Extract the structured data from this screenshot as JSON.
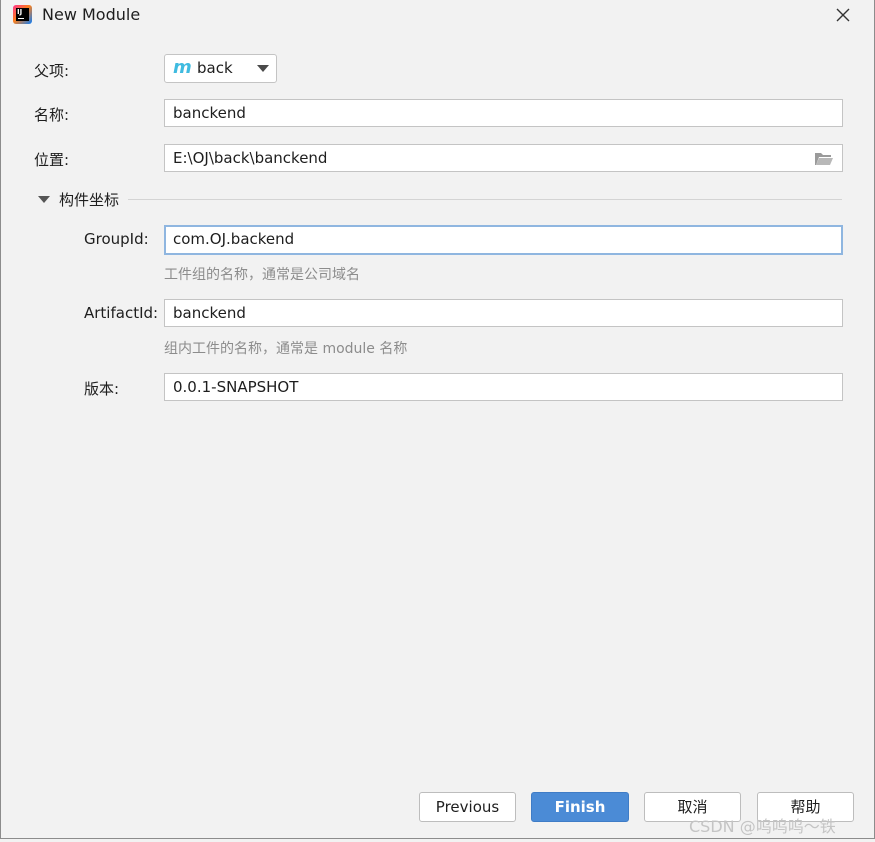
{
  "window": {
    "title": "New Module"
  },
  "parent": {
    "label": "父项:",
    "value": "back",
    "icon": "module-m-icon"
  },
  "name": {
    "label": "名称:",
    "value": "banckend"
  },
  "location": {
    "label": "位置:",
    "value": "E:\\OJ\\back\\banckend"
  },
  "section": {
    "label": "构件坐标"
  },
  "group_id": {
    "label": "GroupId:",
    "value": "com.OJ.backend",
    "hint": "工件组的名称，通常是公司域名"
  },
  "artifact_id": {
    "label": "ArtifactId:",
    "value": "banckend",
    "hint": "组内工件的名称，通常是 module 名称"
  },
  "version": {
    "label": "版本:",
    "value": "0.0.1-SNAPSHOT"
  },
  "buttons": {
    "previous": "Previous",
    "finish": "Finish",
    "cancel": "取消",
    "help": "帮助"
  },
  "watermark": "CSDN @呜呜呜～铁",
  "colors": {
    "primary_button": "#4b8bd6",
    "focus_border": "#8fb6e0",
    "module_icon": "#3fbbe0"
  }
}
